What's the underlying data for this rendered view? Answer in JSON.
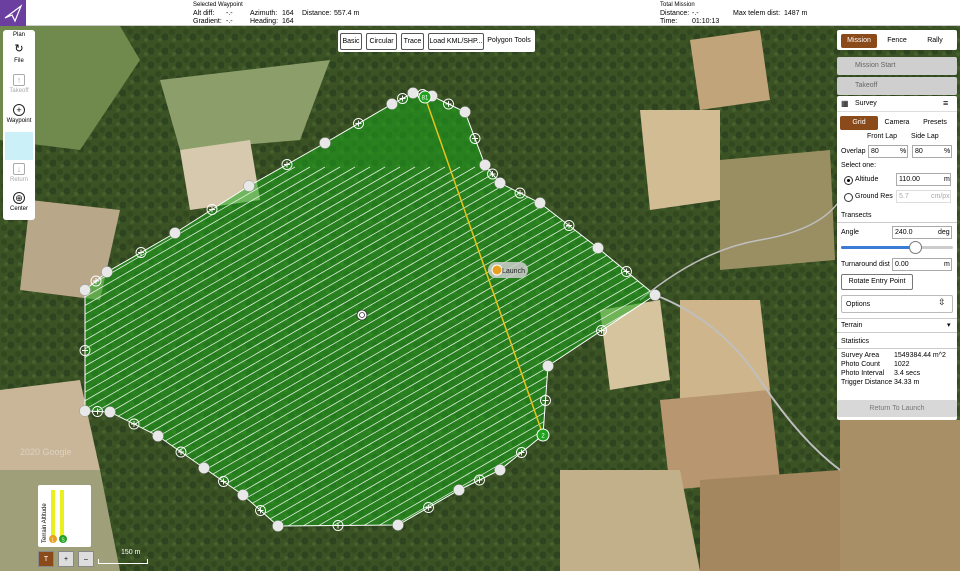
{
  "toolbar": {
    "selected_waypoint_title": "Selected Waypoint",
    "alt_diff_label": "Alt diff:",
    "alt_diff_value": "-.-",
    "gradient_label": "Gradient:",
    "gradient_value": "-.-",
    "azimuth_label": "Azimuth:",
    "azimuth_value": "164",
    "heading_label": "Heading:",
    "heading_value": "164",
    "distance_label": "Distance:",
    "distance_value": "557.4 m",
    "total_mission_title": "Total Mission",
    "total_distance_label": "Distance:",
    "total_distance_value": "-.-",
    "time_label": "Time:",
    "time_value": "01:10:13",
    "max_telem_label": "Max telem dist:",
    "max_telem_value": "1487 m"
  },
  "plan_tools": {
    "plan_label": "Plan",
    "file_label": "File",
    "takeoff_label": "Takeoff",
    "waypoint_label": "Waypoint",
    "return_label": "Return",
    "center_label": "Center"
  },
  "pattern_bar": {
    "basic": "Basic",
    "circular": "Circular",
    "trace": "Trace",
    "load_kml": "Load KML/SHP...",
    "polygon_tools": "Polygon Tools"
  },
  "right_panel": {
    "tabs": [
      "Mission",
      "Fence",
      "Rally"
    ],
    "active_tab": "Mission",
    "mission_start": "Mission Start",
    "takeoff": "Takeoff",
    "survey_title": "Survey",
    "survey_tabs": [
      "Grid",
      "Camera",
      "Presets"
    ],
    "front_lap_label": "Front Lap",
    "side_lap_label": "Side Lap",
    "overlap_label": "Overlap",
    "front_lap_value": "80",
    "side_lap_value": "80",
    "percent": "%",
    "select_one": "Select one:",
    "altitude_label": "Altitude",
    "altitude_value": "110.00",
    "altitude_unit": "m",
    "ground_res_label": "Ground Res",
    "ground_res_value": "5.7",
    "ground_res_unit": "cm/px",
    "transects_label": "Transects",
    "angle_label": "Angle",
    "angle_value": "240.0",
    "angle_unit": "deg",
    "angle_slider_fraction": 0.66,
    "turnaround_label": "Turnaround dist",
    "turnaround_value": "0.00",
    "turnaround_unit": "m",
    "rotate_entry": "Rotate Entry Point",
    "options_label": "Options",
    "terrain_label": "Terrain",
    "statistics_label": "Statistics",
    "stats": [
      {
        "label": "Survey Area",
        "value": "1549384.44 m^2"
      },
      {
        "label": "Photo Count",
        "value": "1022"
      },
      {
        "label": "Photo Interval",
        "value": "3.4 secs"
      },
      {
        "label": "Trigger Distance",
        "value": "34.33 m"
      }
    ],
    "return_to_launch": "Return To Launch"
  },
  "map": {
    "launch_label": "Launch",
    "waypoint_start": "81",
    "waypoint_end": "2",
    "scale_label": "150 m",
    "watermark": "2020 Google"
  },
  "terrain_widget": {
    "label": "Terrain Altitude",
    "marker_a": "L",
    "marker_b": "S"
  },
  "bottom_controls": {
    "t_label": "T",
    "plus": "+",
    "minus": "–"
  },
  "colors": {
    "accent": "#8a4a1a",
    "survey_fill": "#1aa81a",
    "panel_bg": "#ffffff",
    "launch": "#e8a020",
    "purple_logo": "#6b3fa0"
  }
}
